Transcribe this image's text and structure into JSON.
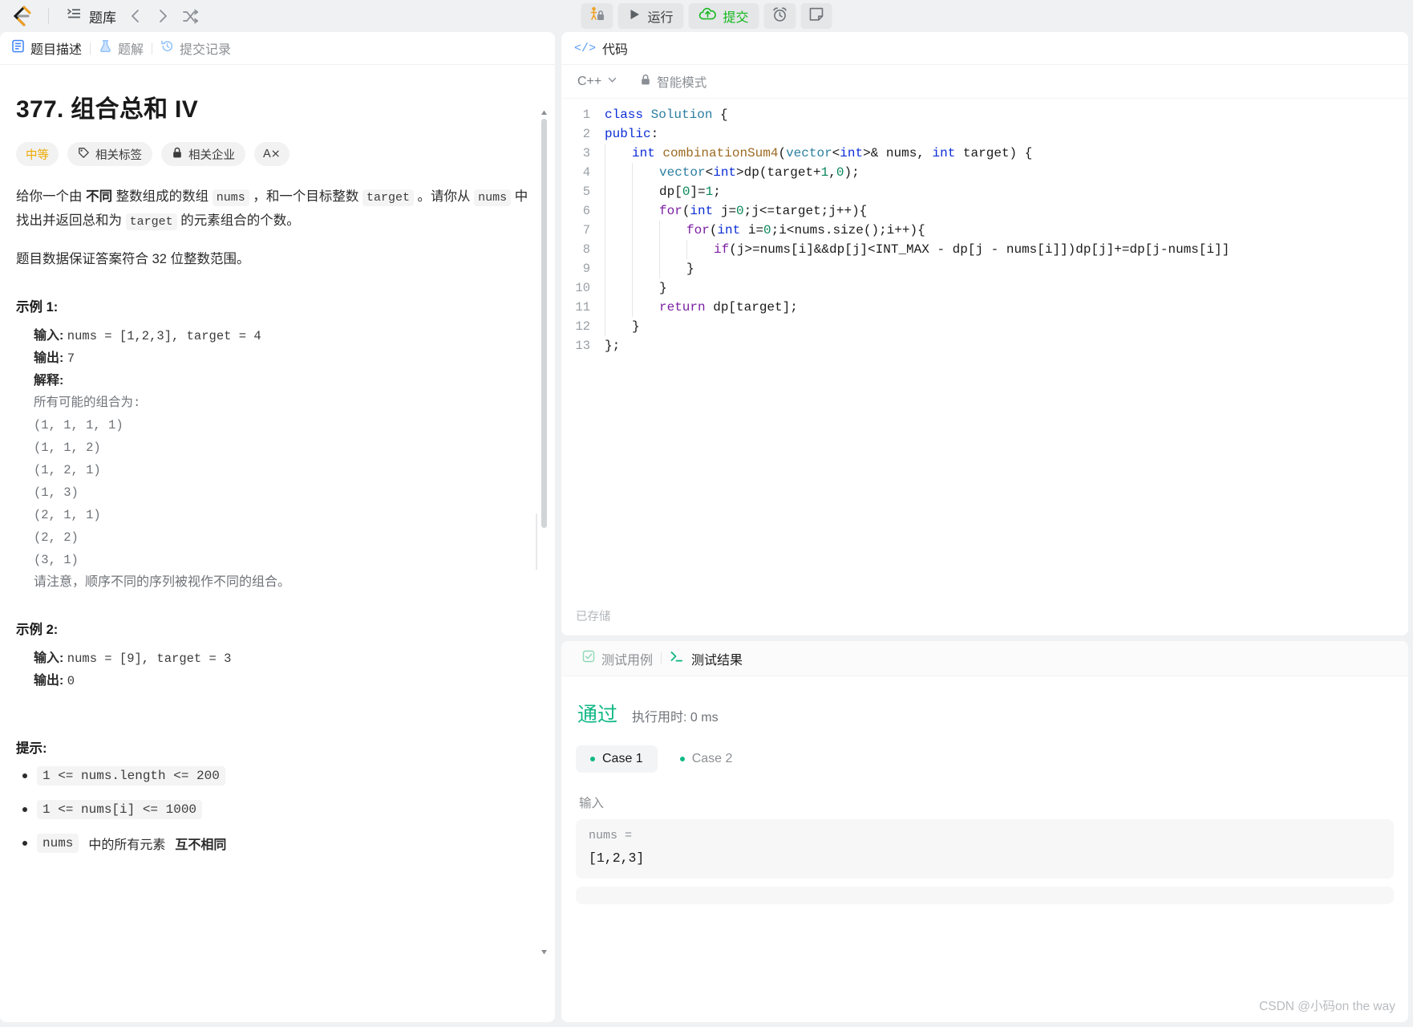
{
  "topbar": {
    "logo_name": "leetcode-logo",
    "problemset_label": "题库",
    "prev_label": "‹",
    "next_label": "›",
    "shuffle_label": "⤫",
    "debug_label": "",
    "run_label": "运行",
    "submit_label": "提交",
    "timer_label": "",
    "note_label": ""
  },
  "left": {
    "tabs": [
      {
        "label": "题目描述",
        "active": true
      },
      {
        "label": "题解",
        "active": false
      },
      {
        "label": "提交记录",
        "active": false
      }
    ],
    "title": "377. 组合总和 IV",
    "chips": [
      {
        "label": "中等",
        "kind": "difficulty"
      },
      {
        "label": "相关标签",
        "kind": "tag"
      },
      {
        "label": "相关企业",
        "kind": "company"
      },
      {
        "label": "A⨯",
        "kind": "translate"
      }
    ],
    "desc_p1_a": "给你一个由 ",
    "desc_p1_b": "不同",
    "desc_p1_c": " 整数组成的数组 ",
    "desc_code_nums": "nums",
    "desc_p1_d": " ，和一个目标整数 ",
    "desc_code_target": "target",
    "desc_p1_e": " 。请你从 ",
    "desc_code_nums2": "nums",
    "desc_p1_f": " 中找出并返回总和为 ",
    "desc_code_target2": "target",
    "desc_p1_g": " 的元素组合的个数。",
    "desc_p2": "题目数据保证答案符合 32 位整数范围。",
    "example1_heading": "示例 1:",
    "example1": {
      "input_label": "输入:",
      "input_value": "nums = [1,2,3], target = 4",
      "output_label": "输出:",
      "output_value": "7",
      "explain_label": "解释:",
      "explain_intro": "所有可能的组合为:",
      "combos": [
        "(1, 1, 1, 1)",
        "(1, 1, 2)",
        "(1, 2, 1)",
        "(1, 3)",
        "(2, 1, 1)",
        "(2, 2)",
        "(3, 1)"
      ],
      "explain_note": "请注意，顺序不同的序列被视作不同的组合。"
    },
    "example2_heading": "示例 2:",
    "example2": {
      "input_label": "输入:",
      "input_value": "nums = [9], target = 3",
      "output_label": "输出:",
      "output_value": "0"
    },
    "hints_heading": "提示:",
    "hints": [
      {
        "code": "1 <= nums.length <= 200",
        "text": ""
      },
      {
        "code": "1 <= nums[i] <= 1000",
        "text": ""
      },
      {
        "code": "nums",
        "text": " 中的所有元素 ",
        "bold": "互不相同"
      }
    ]
  },
  "code": {
    "header_title": "代码",
    "header_icon": "</>",
    "language": "C++",
    "smart_mode": "智能模式",
    "lock_icon": "lock",
    "saved_status": "已存储",
    "lines": [
      {
        "n": "1",
        "indent": 0,
        "tokens": [
          [
            "k",
            "class"
          ],
          [
            "id",
            " "
          ],
          [
            "ty",
            "Solution"
          ],
          [
            "id",
            " {"
          ]
        ]
      },
      {
        "n": "2",
        "indent": 0,
        "tokens": [
          [
            "k",
            "public"
          ],
          [
            "id",
            ":"
          ]
        ]
      },
      {
        "n": "3",
        "indent": 1,
        "tokens": [
          [
            "k",
            "int"
          ],
          [
            "id",
            " "
          ],
          [
            "fn",
            "combinationSum4"
          ],
          [
            "id",
            "("
          ],
          [
            "ty",
            "vector"
          ],
          [
            "id",
            "<"
          ],
          [
            "k",
            "int"
          ],
          [
            "id",
            ">& nums, "
          ],
          [
            "k",
            "int"
          ],
          [
            "id",
            " target) {"
          ]
        ]
      },
      {
        "n": "4",
        "indent": 2,
        "tokens": [
          [
            "ty",
            "vector"
          ],
          [
            "id",
            "<"
          ],
          [
            "k",
            "int"
          ],
          [
            "id",
            ">dp(target+"
          ],
          [
            "cn",
            "1"
          ],
          [
            "id",
            ","
          ],
          [
            "cn",
            "0"
          ],
          [
            "id",
            ");"
          ]
        ]
      },
      {
        "n": "5",
        "indent": 2,
        "tokens": [
          [
            "id",
            "dp["
          ],
          [
            "cn",
            "0"
          ],
          [
            "id",
            "]="
          ],
          [
            "cn",
            "1"
          ],
          [
            "id",
            ";"
          ]
        ]
      },
      {
        "n": "6",
        "indent": 2,
        "tokens": [
          [
            "kp",
            "for"
          ],
          [
            "id",
            "("
          ],
          [
            "k",
            "int"
          ],
          [
            "id",
            " j="
          ],
          [
            "cn",
            "0"
          ],
          [
            "id",
            ";j<=target;j++){"
          ]
        ]
      },
      {
        "n": "7",
        "indent": 3,
        "tokens": [
          [
            "kp",
            "for"
          ],
          [
            "id",
            "("
          ],
          [
            "k",
            "int"
          ],
          [
            "id",
            " i="
          ],
          [
            "cn",
            "0"
          ],
          [
            "id",
            ";i<nums.size();i++){"
          ]
        ]
      },
      {
        "n": "8",
        "indent": 4,
        "tokens": [
          [
            "kp",
            "if"
          ],
          [
            "id",
            "(j>=nums[i]&&dp[j]<INT_MAX - dp[j - nums[i]])dp[j]+=dp[j-nums[i]]"
          ]
        ]
      },
      {
        "n": "9",
        "indent": 3,
        "tokens": [
          [
            "id",
            "}"
          ]
        ]
      },
      {
        "n": "10",
        "indent": 2,
        "tokens": [
          [
            "id",
            "}"
          ]
        ]
      },
      {
        "n": "11",
        "indent": 2,
        "tokens": [
          [
            "kp",
            "return"
          ],
          [
            "id",
            " dp[target];"
          ]
        ]
      },
      {
        "n": "12",
        "indent": 1,
        "tokens": [
          [
            "id",
            "}"
          ]
        ]
      },
      {
        "n": "13",
        "indent": 0,
        "tokens": [
          [
            "id",
            "};"
          ]
        ]
      }
    ]
  },
  "tests": {
    "tabs": [
      {
        "label": "测试用例",
        "active": false,
        "icon": "checkbox-icon"
      },
      {
        "label": "测试结果",
        "active": true,
        "icon": "terminal-icon"
      }
    ],
    "verdict": "通过",
    "runtime_label": "执行用时: 0 ms",
    "cases": [
      {
        "label": "Case 1",
        "active": true
      },
      {
        "label": "Case 2",
        "active": false
      }
    ],
    "input_label": "输入",
    "input_key": "nums =",
    "input_value": "[1,2,3]"
  },
  "watermark": "CSDN @小码on the way",
  "colors": {
    "accent_green": "#14b81b",
    "verdict_green": "#12b886",
    "difficulty_yellow": "#eeaa00",
    "tab_blue": "#5a9cf8"
  }
}
